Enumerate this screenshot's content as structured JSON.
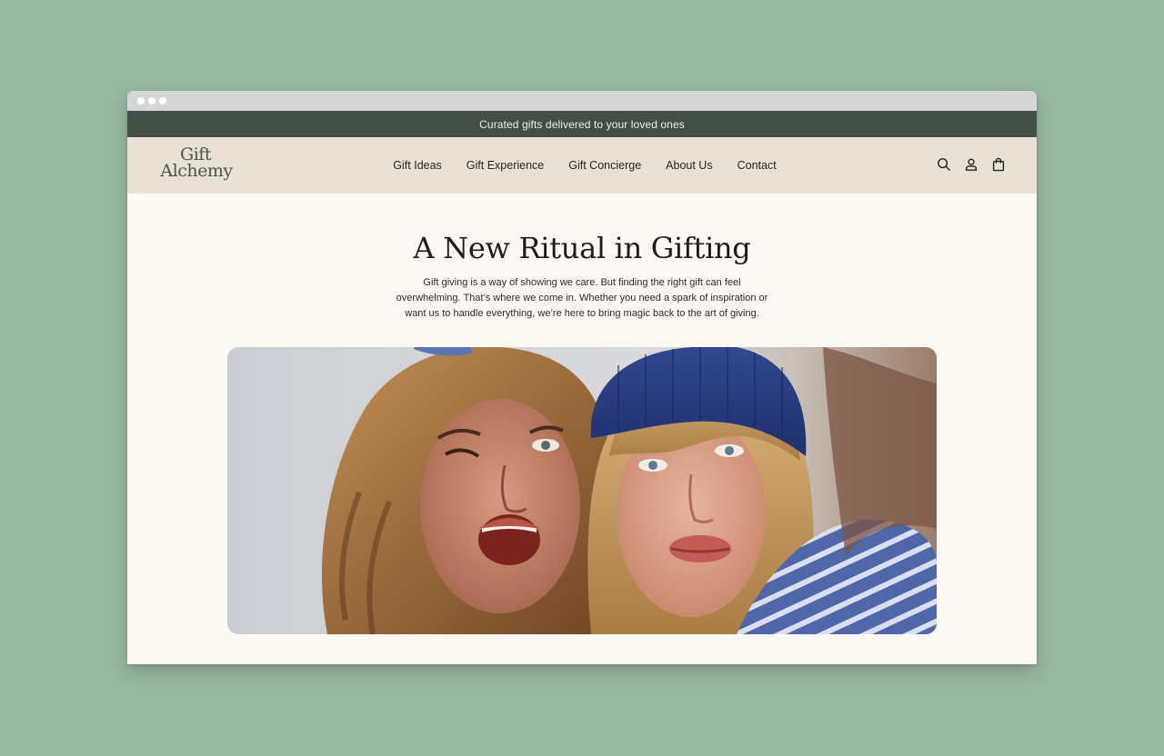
{
  "browser": {
    "window_controls": [
      "dot",
      "dot",
      "dot"
    ]
  },
  "announcement": {
    "text": "Curated gifts delivered to your loved ones"
  },
  "brand": {
    "logo_line1": "Gift",
    "logo_line2": "Alchemy"
  },
  "nav": {
    "items": [
      {
        "label": "Gift Ideas"
      },
      {
        "label": "Gift Experience"
      },
      {
        "label": "Gift Concierge"
      },
      {
        "label": "About Us"
      },
      {
        "label": "Contact"
      }
    ],
    "icons": [
      "search-icon",
      "account-icon",
      "shopping-bag-icon"
    ]
  },
  "hero": {
    "title": "A New Ritual in Gifting",
    "body": "Gift giving is a way of showing we care. But finding the right gift can feel overwhelming. That’s where we come in. Whether you need a spark of inspiration or want us to handle everything, we’re here to bring magic back to the art of giving.",
    "image_description_icon": "photo-two-women-selfie"
  },
  "colors": {
    "page_background": "#97b7a0",
    "announcement_bar": "#434f44",
    "navbar": "#e9e1d6",
    "content_background": "#fcf8f4",
    "beanie_blue": "#2e3f86"
  }
}
